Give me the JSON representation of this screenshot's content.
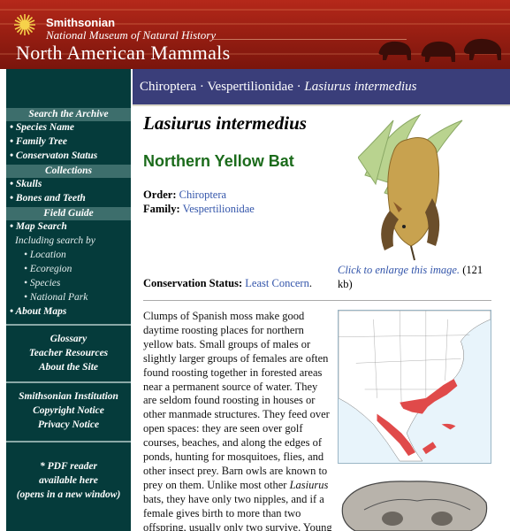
{
  "header": {
    "org": "Smithsonian",
    "museum": "National Museum of Natural History",
    "site_title": "North American Mammals"
  },
  "nav": {
    "search_head": "Search the Archive",
    "search_items": [
      "Species Name",
      "Family Tree",
      "Conservaton Status"
    ],
    "collections_head": "Collections",
    "collections_items": [
      "Skulls",
      "Bones and Teeth"
    ],
    "field_head": "Field Guide",
    "map_search": "Map Search",
    "including": "Including search by",
    "including_items": [
      "Location",
      "Ecoregion",
      "Species",
      "National Park"
    ],
    "about_maps": "About Maps",
    "group1": [
      "Glossary",
      "Teacher Resources",
      "About the Site"
    ],
    "group2": [
      "Smithsonian Institution",
      "Copyright Notice",
      "Privacy Notice"
    ],
    "group3": [
      "* PDF reader",
      "available here",
      "(opens in a new window)"
    ]
  },
  "breadcrumb": {
    "order": "Chiroptera",
    "sep": " · ",
    "family": "Vespertilionidae",
    "species": "Lasiurus intermedius"
  },
  "species": {
    "scientific_name": "Lasiurus intermedius",
    "common_name": "Northern Yellow Bat",
    "order_label": "Order:",
    "order": "Chiroptera",
    "family_label": "Family:",
    "family": "Vespertilionidae",
    "enlarge_text": "Click to enlarge this image.",
    "image_size": "(121 kb)",
    "conservation_label": "Conservation Status:",
    "conservation": "Least Concern",
    "description_before_italic": "Clumps of Spanish moss make good daytime roosting places for northern yellow bats. Small groups of males or slightly larger groups of females are often found roosting together in forested areas near a permanent source of water. They are seldom found roosting in houses or other manmade structures. They feed over open spaces: they are seen over golf courses, beaches, and along the edges of ponds, hunting for mosquitoes, flies, and other insect prey. Barn owls are known to prey on them. Unlike most other ",
    "description_italic": "Lasiurus",
    "description_after_italic": " bats, they have only two nipples, and if a female gives birth to more than two offspring, usually only two survive. Young"
  },
  "colors": {
    "header_red": "#9a1f13",
    "nav_teal": "#053b3b",
    "nav_heading": "#3d6e6c",
    "breadcrumb_blue": "#3a3e7a",
    "common_name_green": "#1b6b1b",
    "link_blue": "#3355aa",
    "range_red": "#e04a4a"
  }
}
